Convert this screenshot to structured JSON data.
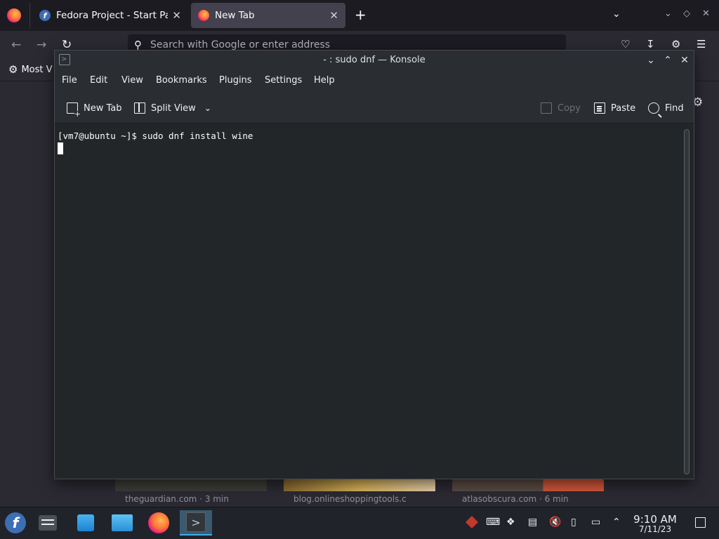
{
  "firefox": {
    "tabs": [
      {
        "title": "Fedora Project - Start Page",
        "close": "✕"
      },
      {
        "title": "New Tab",
        "close": "✕"
      }
    ],
    "new_tab_symbol": "+",
    "url_placeholder": "Search with Google or enter address",
    "bookmark": "Most V",
    "top_sites": [
      {
        "label": "theguardian.com · 3 min"
      },
      {
        "label": "blog.onlineshoppingtools.c"
      },
      {
        "label": "atlasobscura.com · 6 min"
      }
    ]
  },
  "konsole": {
    "title": "- : sudo dnf — Konsole",
    "menu": [
      "File",
      "Edit",
      "View",
      "Bookmarks",
      "Plugins",
      "Settings",
      "Help"
    ],
    "toolbar": {
      "new_tab": "New Tab",
      "split_view": "Split View",
      "copy": "Copy",
      "paste": "Paste",
      "find": "Find"
    },
    "terminal": {
      "prompt": "[vm7@ubuntu ~]$ ",
      "command": "sudo dnf install wine"
    }
  },
  "taskbar": {
    "time": "9:10 AM",
    "date": "7/11/23"
  },
  "icons": {
    "firefox": "firefox-icon",
    "fedora": "fedora-icon",
    "konsole": "konsole-icon"
  },
  "colors": {
    "terminal_bg": "#232629",
    "accent": "#3daee9",
    "firefox_chrome": "#1c1b22"
  }
}
